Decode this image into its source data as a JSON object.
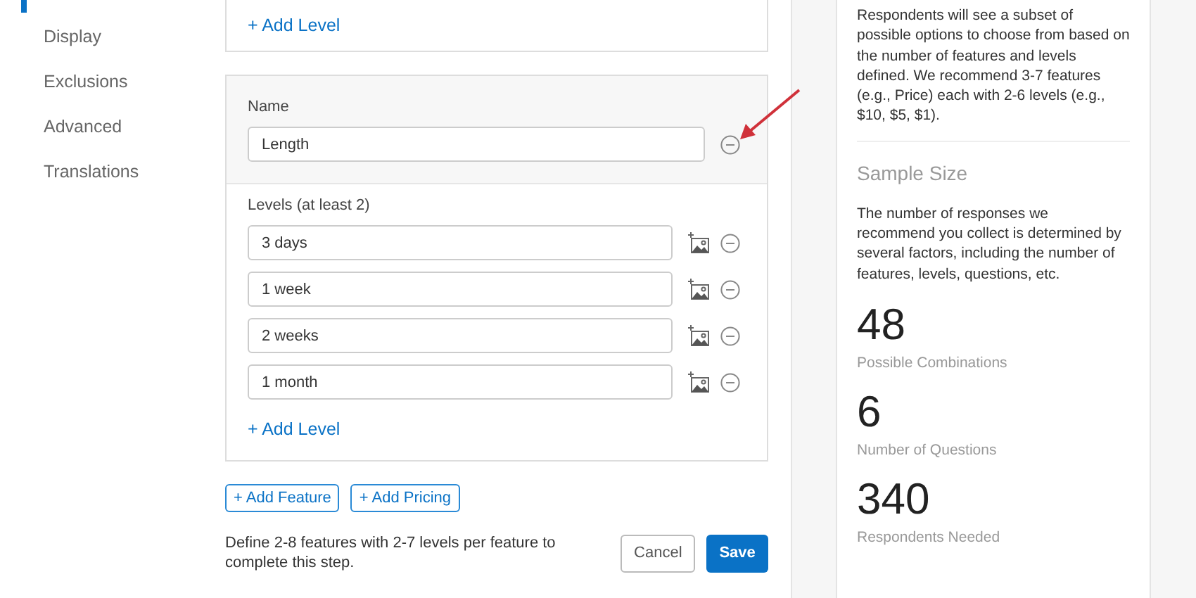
{
  "sidebar": {
    "items": [
      {
        "label": "Display",
        "selected": false
      },
      {
        "label": "Exclusions",
        "selected": false
      },
      {
        "label": "Advanced",
        "selected": false
      },
      {
        "label": "Translations",
        "selected": false
      }
    ]
  },
  "previous_feature": {
    "add_level": "+ Add Level"
  },
  "feature": {
    "name_label": "Name",
    "name_value": "Length",
    "levels_label": "Levels (at least 2)",
    "levels": [
      "3 days",
      "1 week",
      "2 weeks",
      "1 month"
    ],
    "add_level": "+ Add Level"
  },
  "actions": [
    "+ Add Feature",
    "+ Add Pricing"
  ],
  "footer": {
    "hint": "Define 2-8 features with 2-7 levels per feature to complete this step.",
    "cancel": "Cancel",
    "save": "Save"
  },
  "info": {
    "intro": "Respondents will see a subset of possible options to choose from based on the number of features and levels defined. We recommend 3-7 features (e.g., Price) each with 2-6 levels (e.g., $10, $5, $1).",
    "sample_title": "Sample Size",
    "sample_text": "The number of responses we recommend you collect is determined by several factors, including the number of features, levels, questions, etc.",
    "stats": [
      {
        "value": "48",
        "label": "Possible Combinations"
      },
      {
        "value": "6",
        "label": "Number of Questions"
      },
      {
        "value": "340",
        "label": "Respondents Needed"
      }
    ]
  }
}
